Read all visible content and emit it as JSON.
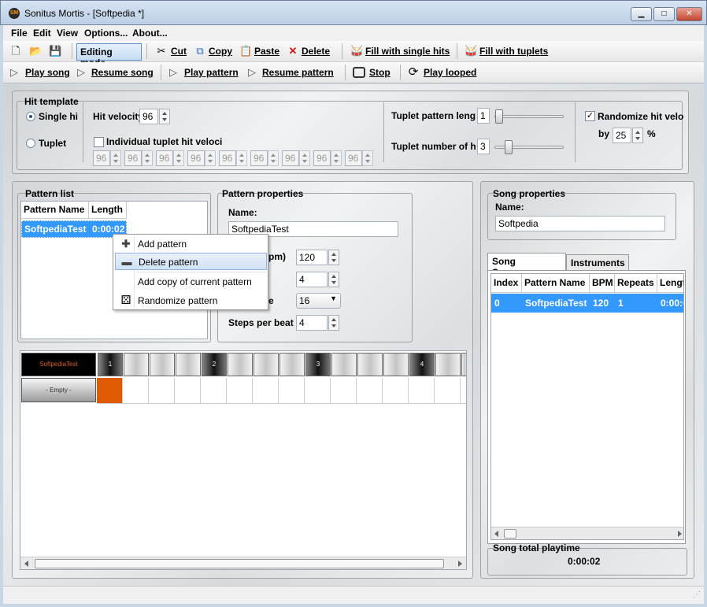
{
  "window": {
    "title": "Sonitus Mortis - [Softpedia *]",
    "icon_text": "SM"
  },
  "menu": [
    "File",
    "Edit",
    "View",
    "Options...",
    "About..."
  ],
  "toolbar1": {
    "editing_mode": "Editing mode",
    "cut": "Cut",
    "copy": "Copy",
    "paste": "Paste",
    "delete": "Delete",
    "fill_single": "Fill with single hits",
    "fill_tuplets": "Fill with tuplets"
  },
  "toolbar2": {
    "play_song": "Play song",
    "resume_song": "Resume song",
    "play_pattern": "Play pattern",
    "resume_pattern": "Resume pattern",
    "stop": "Stop",
    "play_looped": "Play looped"
  },
  "hit_template": {
    "title": "Hit template",
    "single_hit": "Single hi",
    "tuplet": "Tuplet",
    "hit_velocity_label": "Hit velocity",
    "hit_velocity": "96",
    "individual_label": "Individual tuplet hit veloci",
    "tuplet_velocities": [
      "96",
      "96",
      "96",
      "96",
      "96",
      "96",
      "96",
      "96",
      "96"
    ],
    "tuplet_length_label": "Tuplet pattern leng",
    "tuplet_length": "1",
    "tuplet_number_label": "Tuplet number of h",
    "tuplet_number": "3",
    "randomize_label": "Randomize hit veloc",
    "by_label": "by",
    "by_value": "25",
    "percent": "%"
  },
  "pattern_list": {
    "title": "Pattern list",
    "columns": [
      "Pattern Name",
      "Length"
    ],
    "rows": [
      {
        "name": "SoftpediaTest",
        "length": "0:00:02"
      }
    ]
  },
  "context_menu": {
    "items": [
      "Add pattern",
      "Delete pattern",
      "Add copy of current pattern",
      "Randomize pattern"
    ]
  },
  "pattern_properties": {
    "title": "Pattern properties",
    "name_label": "Name:",
    "name_value": "SoftpediaTest",
    "bpm_label": "pm)",
    "bpm_value": "120",
    "field2_value": "4",
    "field3_label": "e",
    "field3_value": "16",
    "steps_label": "Steps per beat",
    "steps_value": "4"
  },
  "grid": {
    "pattern_name": "SoftpediaTest",
    "track_name": "- Empty -",
    "beat_labels": [
      "1",
      "2",
      "3",
      "4"
    ],
    "active_color": "#e05a00"
  },
  "song_properties": {
    "title": "Song properties",
    "name_label": "Name:",
    "name_value": "Softpedia"
  },
  "song_tabs": [
    "Song Sequence",
    "Instruments"
  ],
  "song_sequence": {
    "columns": [
      "Index",
      "Pattern Name",
      "BPM",
      "Repeats",
      "Lengt"
    ],
    "rows": [
      {
        "index": "0",
        "pattern": "SoftpediaTest",
        "bpm": "120",
        "repeats": "1",
        "length": "0:00:0"
      }
    ]
  },
  "playtime": {
    "label": "Song total playtime",
    "value": "0:00:02"
  }
}
